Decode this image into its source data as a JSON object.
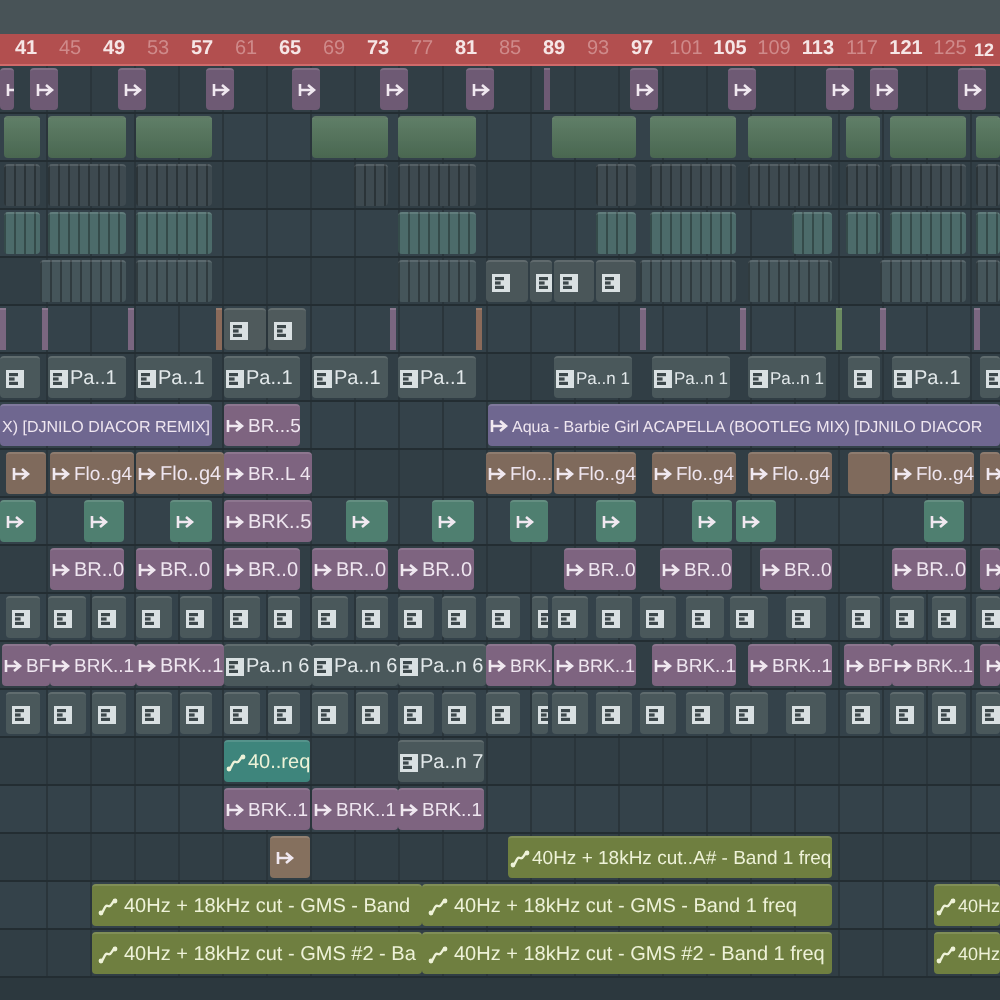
{
  "ruler": {
    "ticks": [
      {
        "label": "41",
        "major": true
      },
      {
        "label": "45",
        "major": false
      },
      {
        "label": "49",
        "major": true
      },
      {
        "label": "53",
        "major": false
      },
      {
        "label": "57",
        "major": true
      },
      {
        "label": "61",
        "major": false
      },
      {
        "label": "65",
        "major": true
      },
      {
        "label": "69",
        "major": false
      },
      {
        "label": "73",
        "major": true
      },
      {
        "label": "77",
        "major": false
      },
      {
        "label": "81",
        "major": true
      },
      {
        "label": "85",
        "major": false
      },
      {
        "label": "89",
        "major": true
      },
      {
        "label": "93",
        "major": false
      },
      {
        "label": "97",
        "major": true
      },
      {
        "label": "101",
        "major": false
      },
      {
        "label": "105",
        "major": true
      },
      {
        "label": "109",
        "major": false
      },
      {
        "label": "113",
        "major": true
      },
      {
        "label": "117",
        "major": false
      },
      {
        "label": "121",
        "major": true
      },
      {
        "label": "125",
        "major": false
      },
      {
        "label": "12",
        "major": true
      }
    ]
  },
  "tracks": [
    {
      "clips": [
        {
          "kind": "audio",
          "color": "#6e5a74"
        },
        {
          "kind": "audio",
          "color": "#6e5a74"
        },
        {
          "kind": "audio",
          "color": "#6e5a74"
        },
        {
          "kind": "audio",
          "color": "#6e5a74"
        },
        {
          "kind": "audio",
          "color": "#6e5a74"
        },
        {
          "kind": "audio",
          "color": "#6e5a74"
        },
        {
          "kind": "audio",
          "color": "#6e5a74"
        },
        {
          "kind": "line",
          "color": "#6e5a74"
        },
        {
          "kind": "audio",
          "color": "#6e5a74"
        },
        {
          "kind": "audio",
          "color": "#6e5a74"
        },
        {
          "kind": "audio",
          "color": "#6e5a74"
        },
        {
          "kind": "audio",
          "color": "#6e5a74"
        },
        {
          "kind": "audio",
          "color": "#6e5a74"
        }
      ]
    },
    {
      "clips": [
        {
          "kind": "notes",
          "color": "#52735a"
        },
        {
          "kind": "notes",
          "color": "#52735a"
        },
        {
          "kind": "notes",
          "color": "#52735a"
        },
        {
          "kind": "notes",
          "color": "#52735a"
        },
        {
          "kind": "notes",
          "color": "#52735a"
        },
        {
          "kind": "notes",
          "color": "#52735a"
        },
        {
          "kind": "notes",
          "color": "#52735a"
        },
        {
          "kind": "notes",
          "color": "#52735a"
        },
        {
          "kind": "notes",
          "color": "#52735a"
        },
        {
          "kind": "notes",
          "color": "#52735a"
        },
        {
          "kind": "notes",
          "color": "#52735a"
        }
      ]
    },
    {
      "clips": [
        {
          "kind": "stripes",
          "color": "#3e4a50"
        },
        {
          "kind": "stripes",
          "color": "#3e4a50"
        },
        {
          "kind": "stripes",
          "color": "#3e4a50"
        },
        {
          "kind": "stripes",
          "color": "#3e4a50"
        },
        {
          "kind": "stripes",
          "color": "#3e4a50"
        },
        {
          "kind": "stripes",
          "color": "#3e4a50"
        },
        {
          "kind": "stripes",
          "color": "#3e4a50"
        },
        {
          "kind": "stripes",
          "color": "#3e4a50"
        },
        {
          "kind": "stripes",
          "color": "#3e4a50"
        },
        {
          "kind": "stripes",
          "color": "#3e4a50"
        },
        {
          "kind": "stripes",
          "color": "#3e4a50"
        }
      ]
    },
    {
      "clips": [
        {
          "kind": "stripes",
          "color": "#4c6b6a"
        },
        {
          "kind": "stripes",
          "color": "#4c6b6a"
        },
        {
          "kind": "stripes",
          "color": "#4c6b6a"
        },
        {
          "kind": "stripes",
          "color": "#4c6b6a"
        },
        {
          "kind": "stripes",
          "color": "#4c6b6a"
        },
        {
          "kind": "stripes",
          "color": "#4c6b6a"
        },
        {
          "kind": "stripes",
          "color": "#4c6b6a"
        },
        {
          "kind": "stripes",
          "color": "#4c6b6a"
        },
        {
          "kind": "stripes",
          "color": "#4c6b6a"
        },
        {
          "kind": "stripes",
          "color": "#4c6b6a"
        }
      ]
    },
    {
      "clips": [
        {
          "kind": "stripes",
          "color": "#45555a"
        },
        {
          "kind": "stripes",
          "color": "#45555a"
        },
        {
          "kind": "stripes",
          "color": "#45555a"
        },
        {
          "kind": "pattern",
          "color": "#4a5659"
        },
        {
          "kind": "pattern",
          "color": "#4a5659"
        },
        {
          "kind": "pattern",
          "color": "#4a5659"
        },
        {
          "kind": "pattern",
          "color": "#4a5659"
        },
        {
          "kind": "stripes",
          "color": "#45555a"
        },
        {
          "kind": "stripes",
          "color": "#45555a"
        },
        {
          "kind": "stripes",
          "color": "#45555a"
        },
        {
          "kind": "stripes",
          "color": "#45555a"
        }
      ]
    },
    {
      "clips": [
        {
          "kind": "line",
          "color": "#7a6680"
        },
        {
          "kind": "line",
          "color": "#7a6680"
        },
        {
          "kind": "line",
          "color": "#7a6680"
        },
        {
          "kind": "line",
          "color": "#8a6a5a"
        },
        {
          "kind": "pattern",
          "color": "#4f5a5c"
        },
        {
          "kind": "pattern",
          "color": "#4f5a5c"
        },
        {
          "kind": "line",
          "color": "#7a6680"
        },
        {
          "kind": "line",
          "color": "#8a6a5a"
        },
        {
          "kind": "line",
          "color": "#7a6680"
        },
        {
          "kind": "line",
          "color": "#7a6680"
        },
        {
          "kind": "line",
          "color": "#6a8a60"
        },
        {
          "kind": "line",
          "color": "#7a6680"
        },
        {
          "kind": "line",
          "color": "#7a6680"
        }
      ]
    },
    {
      "clips": [
        {
          "kind": "pattern",
          "color": "#4a585b"
        },
        {
          "kind": "pattern",
          "color": "#4a585b",
          "label": "Pa..1"
        },
        {
          "kind": "pattern",
          "color": "#4a585b",
          "label": "Pa..1"
        },
        {
          "kind": "pattern",
          "color": "#4a585b",
          "label": "Pa..1"
        },
        {
          "kind": "pattern",
          "color": "#4a585b",
          "label": "Pa..1"
        },
        {
          "kind": "pattern",
          "color": "#4a585b",
          "label": "Pa..1"
        },
        {
          "kind": "pattern",
          "color": "#4a585b",
          "label": "Pa..n 1"
        },
        {
          "kind": "pattern",
          "color": "#4a585b",
          "label": "Pa..n 1"
        },
        {
          "kind": "pattern",
          "color": "#4a585b",
          "label": "Pa..n 1"
        },
        {
          "kind": "pattern",
          "color": "#4a585b"
        },
        {
          "kind": "pattern",
          "color": "#4a585b",
          "label": "Pa..1"
        },
        {
          "kind": "pattern",
          "color": "#4a585b"
        }
      ]
    },
    {
      "clips": [
        {
          "kind": "clipped",
          "color": "#6f6790",
          "label": "X) [DJNILO DIACOR REMIX]"
        },
        {
          "kind": "audio",
          "color": "#7e6480",
          "label": "BR...5"
        },
        {
          "kind": "audio",
          "color": "#6f6790",
          "label": "Aqua - Barbie Girl ACAPELLA (BOOTLEG MIX) [DJNILO DIACOR"
        }
      ]
    },
    {
      "clips": [
        {
          "kind": "audio",
          "color": "#7f6a5c"
        },
        {
          "kind": "audio",
          "color": "#7f6a5c",
          "label": "Flo..g4"
        },
        {
          "kind": "audio",
          "color": "#7f6a5c",
          "label": "Flo..g4"
        },
        {
          "kind": "audio",
          "color": "#7e6480",
          "label": "BR..L 4"
        },
        {
          "kind": "audio",
          "color": "#7f6a5c",
          "label": "Flo..."
        },
        {
          "kind": "audio",
          "color": "#7f6a5c",
          "label": "Flo..g4"
        },
        {
          "kind": "audio",
          "color": "#7f6a5c",
          "label": "Flo..g4"
        },
        {
          "kind": "audio",
          "color": "#7f6a5c",
          "label": "Flo..g4"
        },
        {
          "kind": "clipped",
          "color": "#7f6a5c"
        },
        {
          "kind": "audio",
          "color": "#7f6a5c",
          "label": "Flo..g4"
        },
        {
          "kind": "audio",
          "color": "#7f6a5c"
        }
      ]
    },
    {
      "clips": [
        {
          "kind": "audio",
          "color": "#4f7f70"
        },
        {
          "kind": "audio",
          "color": "#4f7f70"
        },
        {
          "kind": "audio",
          "color": "#4f7f70"
        },
        {
          "kind": "audio",
          "color": "#7e6480",
          "label": "BRK..5"
        },
        {
          "kind": "audio",
          "color": "#4f7f70"
        },
        {
          "kind": "audio",
          "color": "#4f7f70"
        },
        {
          "kind": "audio",
          "color": "#4f7f70"
        },
        {
          "kind": "audio",
          "color": "#4f7f70"
        },
        {
          "kind": "audio",
          "color": "#4f7f70"
        },
        {
          "kind": "audio",
          "color": "#4f7f70"
        },
        {
          "kind": "audio",
          "color": "#4f7f70"
        }
      ]
    },
    {
      "clips": [
        {
          "kind": "audio",
          "color": "#7e6480",
          "label": "BR..0"
        },
        {
          "kind": "audio",
          "color": "#7e6480",
          "label": "BR..0"
        },
        {
          "kind": "audio",
          "color": "#7e6480",
          "label": "BR..0"
        },
        {
          "kind": "audio",
          "color": "#7e6480",
          "label": "BR..0"
        },
        {
          "kind": "audio",
          "color": "#7e6480",
          "label": "BR..0"
        },
        {
          "kind": "audio",
          "color": "#7e6480",
          "label": "BR..0"
        },
        {
          "kind": "audio",
          "color": "#7e6480",
          "label": "BR..0"
        },
        {
          "kind": "audio",
          "color": "#7e6480",
          "label": "BR..0"
        },
        {
          "kind": "audio",
          "color": "#7e6480",
          "label": "BR..0"
        },
        {
          "kind": "audio",
          "color": "#7e6480"
        }
      ]
    },
    {
      "clips": [
        {
          "kind": "pattern",
          "color": "#4a585b"
        },
        {
          "kind": "pattern",
          "color": "#4a585b"
        },
        {
          "kind": "pattern",
          "color": "#4a585b"
        },
        {
          "kind": "pattern",
          "color": "#4a585b"
        },
        {
          "kind": "pattern",
          "color": "#4a585b"
        },
        {
          "kind": "pattern",
          "color": "#4a585b"
        },
        {
          "kind": "pattern",
          "color": "#4a585b"
        },
        {
          "kind": "pattern",
          "color": "#4a585b"
        },
        {
          "kind": "pattern",
          "color": "#4a585b"
        },
        {
          "kind": "pattern",
          "color": "#4a585b"
        },
        {
          "kind": "pattern",
          "color": "#4a585b"
        },
        {
          "kind": "pattern",
          "color": "#4a585b"
        },
        {
          "kind": "pattern",
          "color": "#4a585b"
        },
        {
          "kind": "pattern",
          "color": "#4a585b"
        },
        {
          "kind": "pattern",
          "color": "#4a585b"
        },
        {
          "kind": "pattern",
          "color": "#4a585b"
        },
        {
          "kind": "pattern",
          "color": "#4a585b"
        },
        {
          "kind": "pattern",
          "color": "#4a585b"
        },
        {
          "kind": "pattern",
          "color": "#4a585b"
        },
        {
          "kind": "pattern",
          "color": "#4a585b"
        },
        {
          "kind": "pattern",
          "color": "#4a585b"
        },
        {
          "kind": "pattern",
          "color": "#4a585b"
        },
        {
          "kind": "pattern",
          "color": "#4a585b"
        }
      ]
    },
    {
      "clips": [
        {
          "kind": "audio",
          "color": "#7e6480",
          "label": "BF"
        },
        {
          "kind": "audio",
          "color": "#7e6480",
          "label": "BRK..1"
        },
        {
          "kind": "audio",
          "color": "#7e6480",
          "label": "BRK..1"
        },
        {
          "kind": "pattern",
          "color": "#4a585b",
          "label": "Pa..n 6"
        },
        {
          "kind": "pattern",
          "color": "#4a585b",
          "label": "Pa..n 6"
        },
        {
          "kind": "pattern",
          "color": "#4a585b",
          "label": "Pa..n 6"
        },
        {
          "kind": "audio",
          "color": "#7e6480",
          "label": "BRK."
        },
        {
          "kind": "audio",
          "color": "#7e6480",
          "label": "BRK..1"
        },
        {
          "kind": "audio",
          "color": "#7e6480",
          "label": "BRK..1"
        },
        {
          "kind": "audio",
          "color": "#7e6480",
          "label": "BRK..1"
        },
        {
          "kind": "audio",
          "color": "#7e6480",
          "label": "BF"
        },
        {
          "kind": "audio",
          "color": "#7e6480",
          "label": "BRK..1"
        },
        {
          "kind": "audio",
          "color": "#7e6480"
        }
      ]
    },
    {
      "clips": [
        {
          "kind": "pattern",
          "color": "#4a585b"
        },
        {
          "kind": "pattern",
          "color": "#4a585b"
        },
        {
          "kind": "pattern",
          "color": "#4a585b"
        },
        {
          "kind": "pattern",
          "color": "#4a585b"
        },
        {
          "kind": "pattern",
          "color": "#4a585b"
        },
        {
          "kind": "pattern",
          "color": "#4a585b"
        },
        {
          "kind": "pattern",
          "color": "#4a585b"
        },
        {
          "kind": "pattern",
          "color": "#4a585b"
        },
        {
          "kind": "pattern",
          "color": "#4a585b"
        },
        {
          "kind": "pattern",
          "color": "#4a585b"
        },
        {
          "kind": "pattern",
          "color": "#4a585b"
        },
        {
          "kind": "pattern",
          "color": "#4a585b"
        },
        {
          "kind": "pattern",
          "color": "#4a585b"
        },
        {
          "kind": "pattern",
          "color": "#4a585b"
        },
        {
          "kind": "pattern",
          "color": "#4a585b"
        },
        {
          "kind": "pattern",
          "color": "#4a585b"
        },
        {
          "kind": "pattern",
          "color": "#4a585b"
        },
        {
          "kind": "pattern",
          "color": "#4a585b"
        },
        {
          "kind": "pattern",
          "color": "#4a585b"
        },
        {
          "kind": "pattern",
          "color": "#4a585b"
        },
        {
          "kind": "pattern",
          "color": "#4a585b"
        },
        {
          "kind": "pattern",
          "color": "#4a585b"
        },
        {
          "kind": "pattern",
          "color": "#4a585b"
        }
      ]
    },
    {
      "clips": [
        {
          "kind": "automation",
          "color": "#3e857c",
          "label": "40..req"
        },
        {
          "kind": "pattern",
          "color": "#4a585b",
          "label": "Pa..n 7"
        }
      ]
    },
    {
      "clips": [
        {
          "kind": "audio",
          "color": "#7e6480",
          "label": "BRK..1"
        },
        {
          "kind": "audio",
          "color": "#7e6480",
          "label": "BRK..1"
        },
        {
          "kind": "audio",
          "color": "#7e6480",
          "label": "BRK..1"
        }
      ]
    },
    {
      "clips": [
        {
          "kind": "audio",
          "color": "#85705e"
        },
        {
          "kind": "automation",
          "color": "#6f7f40",
          "label": "40Hz + 18kHz cut..A# - Band 1 freq"
        }
      ]
    },
    {
      "clips": [
        {
          "kind": "automation",
          "color": "#6f7f40",
          "label": "40Hz + 18kHz cut - GMS - Band"
        },
        {
          "kind": "automation",
          "color": "#6f7f40",
          "label": "40Hz + 18kHz cut - GMS - Band 1 freq"
        },
        {
          "kind": "automation",
          "color": "#6f7f40",
          "label": "40Hz"
        }
      ]
    },
    {
      "clips": [
        {
          "kind": "automation",
          "color": "#6f7f40",
          "label": "40Hz + 18kHz cut - GMS #2 - Ba"
        },
        {
          "kind": "automation",
          "color": "#6f7f40",
          "label": "40Hz + 18kHz cut - GMS #2 - Band 1 freq"
        },
        {
          "kind": "automation",
          "color": "#6f7f40",
          "label": "40Hz"
        }
      ]
    }
  ]
}
